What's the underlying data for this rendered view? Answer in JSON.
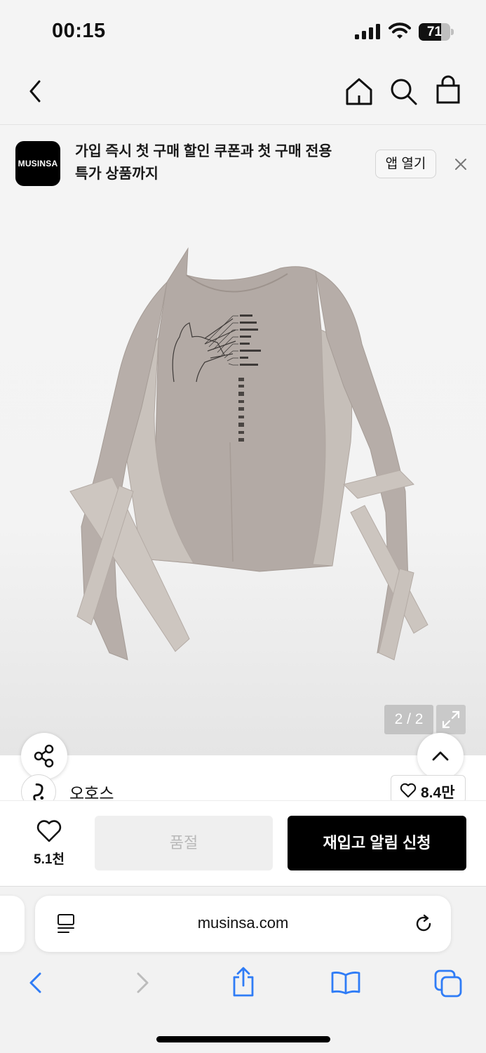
{
  "status_bar": {
    "time": "00:15",
    "battery": "71",
    "battery_level": 0.71
  },
  "nav": {
    "back": "back-arrow-icon",
    "home": "home-icon",
    "search": "search-icon",
    "cart": "shopping-bag-icon"
  },
  "promo": {
    "logo": "MUSINSA",
    "text_line1": "가입 즉시 첫 구매 할인 쿠폰과 첫 구매 전용",
    "text_line2": "특가 상품까지",
    "open_app": "앱 열기"
  },
  "gallery": {
    "counter": "2 / 2"
  },
  "brand": {
    "name": "오호스",
    "likes": "8.4만"
  },
  "actions": {
    "likes": "5.1천",
    "sold_out": "품절",
    "restock_alert": "재입고 알림 신청"
  },
  "browser": {
    "url": "musinsa.com"
  },
  "colors": {
    "accent": "#000000",
    "accent_ios": "#2f7cf6",
    "disabled": "#efefef"
  }
}
